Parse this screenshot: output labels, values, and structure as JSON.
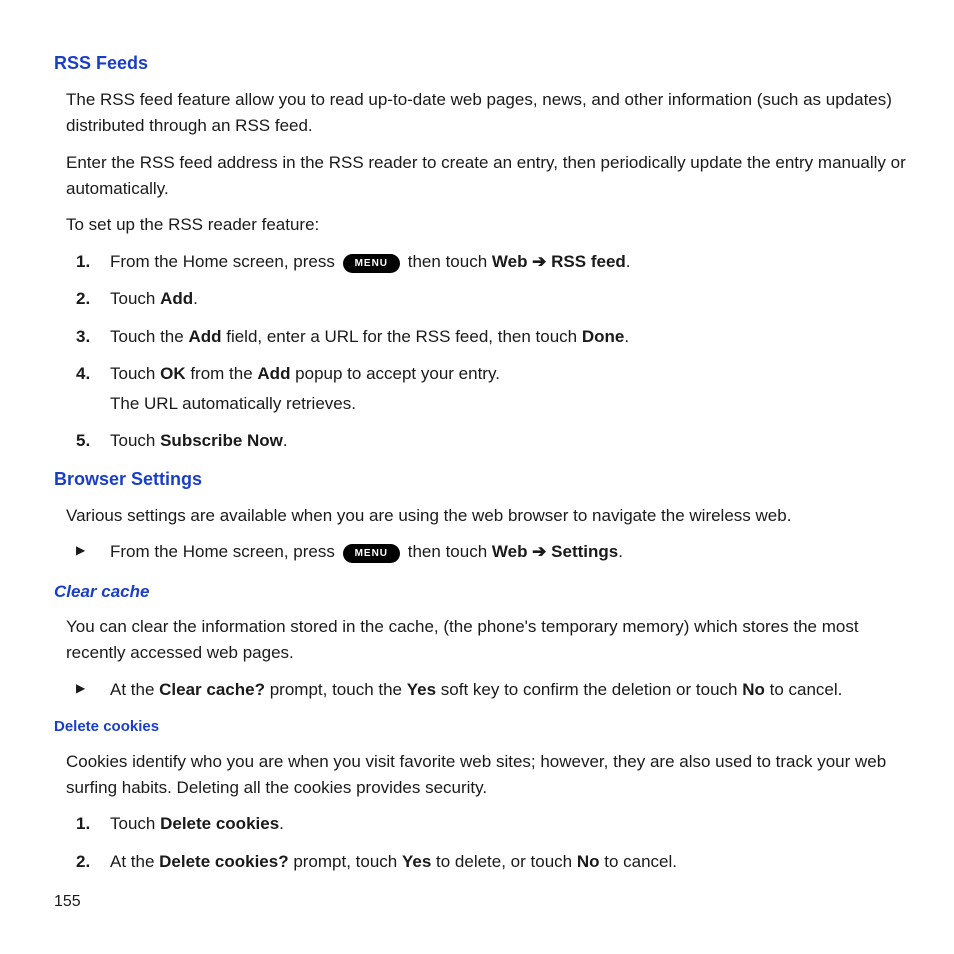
{
  "pageNumber": "155",
  "menuLabel": "MENU",
  "arrow": " ➔ ",
  "rss": {
    "heading": "RSS Feeds",
    "intro1": "The RSS feed feature allow you to read up-to-date web pages, news, and other information (such as updates) distributed through an RSS feed.",
    "intro2": "Enter the RSS feed address in the RSS reader to create an entry, then periodically update the entry manually or automatically.",
    "setup": "To set up the RSS reader feature:",
    "s1a": "From the Home screen, press ",
    "s1b": " then touch ",
    "s1web": "Web",
    "s1rss": "RSS feed",
    "s2a": "Touch ",
    "s2add": "Add",
    "s3a": "Touch the ",
    "s3add": "Add",
    "s3b": " field, enter a URL for the RSS feed, then touch ",
    "s3done": "Done",
    "s4a": "Touch ",
    "s4ok": "OK",
    "s4b": " from the ",
    "s4add": "Add",
    "s4c": " popup to accept your entry.",
    "s4sub": "The URL automatically retrieves.",
    "s5a": "Touch ",
    "s5sub": "Subscribe Now"
  },
  "browser": {
    "heading": "Browser Settings",
    "intro": "Various settings are available when you are using the web browser to navigate the wireless web.",
    "b1a": "From the Home screen, press ",
    "b1b": " then touch ",
    "b1web": "Web",
    "b1settings": "Settings"
  },
  "cache": {
    "heading": "Clear cache",
    "intro": "You can clear the information stored in the cache, (the phone's temporary memory) which stores the most recently accessed web pages.",
    "c1a": "At the ",
    "c1prompt": "Clear cache?",
    "c1b": " prompt, touch the ",
    "c1yes": "Yes",
    "c1c": " soft key to confirm the deletion or touch ",
    "c1no": "No",
    "c1d": " to cancel."
  },
  "cookies": {
    "heading": "Delete cookies",
    "intro": "Cookies identify who you are when you visit favorite web sites; however, they are also used to track your web surfing habits. Deleting all the cookies provides security.",
    "d1a": "Touch ",
    "d1del": "Delete cookies",
    "d2a": "At the ",
    "d2prompt": "Delete cookies?",
    "d2b": " prompt, touch ",
    "d2yes": "Yes",
    "d2c": " to delete, or touch ",
    "d2no": "No",
    "d2d": " to cancel."
  }
}
